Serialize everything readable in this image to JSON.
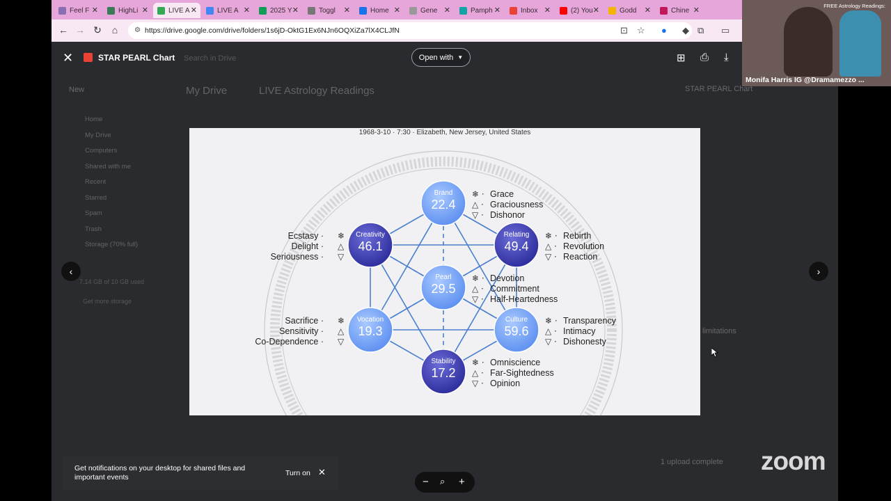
{
  "tabs": [
    {
      "label": "Feel F",
      "color": "#8a6fb0"
    },
    {
      "label": "HighLi",
      "color": "#3b7a57"
    },
    {
      "label": "LIVE A",
      "color": "#34a853",
      "active": true
    },
    {
      "label": "LIVE A",
      "color": "#4285f4"
    },
    {
      "label": "2025 Y",
      "color": "#0f9d58"
    },
    {
      "label": "Toggl",
      "color": "#777777"
    },
    {
      "label": "Home",
      "color": "#1a73e8"
    },
    {
      "label": "Gene",
      "color": "#999999"
    },
    {
      "label": "Pamph",
      "color": "#12a4a4"
    },
    {
      "label": "Inbox",
      "color": "#ea4335"
    },
    {
      "label": "(2) You",
      "color": "#ff0000"
    },
    {
      "label": "Godd",
      "color": "#f4b400"
    },
    {
      "label": "Chine",
      "color": "#c2185b"
    }
  ],
  "address": {
    "url": "https://drive.google.com/drive/folders/1s6jD-OktG1Ex6NJn6OQXiZa7lX4CLJfN"
  },
  "viewer": {
    "file_title": "STAR PEARL Chart",
    "open_with": "Open with",
    "bg_search": "Search in Drive",
    "bg_breadcrumb_1": "My Drive",
    "bg_breadcrumb_2": "LIVE Astrology Readings",
    "bg_new": "New",
    "bg_side_items": [
      "Home",
      "My Drive",
      "Computers",
      "Shared with me",
      "Recent",
      "Starred",
      "Spam",
      "Trash",
      "Storage (70% full)"
    ],
    "bg_storage": "7.14 GB of 10 GB used",
    "bg_get_storage": "Get more storage",
    "bg_right_title": "STAR PEARL Chart",
    "bg_upload": "1 upload complete",
    "bg_limitations": "limitations"
  },
  "chart": {
    "header": "1968-3-10 · 7:30 · Elizabeth, New Jersey, United States",
    "nodes": [
      {
        "name": "Brand",
        "value": "22.4",
        "traits": [
          "Grace",
          "Graciousness",
          "Dishonor"
        ],
        "side": "right"
      },
      {
        "name": "Creativity",
        "value": "46.1",
        "traits": [
          "Ecstasy",
          "Delight",
          "Seriousness"
        ],
        "side": "left"
      },
      {
        "name": "Relating",
        "value": "49.4",
        "traits": [
          "Rebirth",
          "Revolution",
          "Reaction"
        ],
        "side": "right"
      },
      {
        "name": "Pearl",
        "value": "29.5",
        "traits": [
          "Devotion",
          "Commitment",
          "Half-Heartedness"
        ],
        "side": "right"
      },
      {
        "name": "Vocation",
        "value": "19.3",
        "traits": [
          "Sacrifice",
          "Sensitivity",
          "Co-Dependence"
        ],
        "side": "left"
      },
      {
        "name": "Culture",
        "value": "59.6",
        "traits": [
          "Transparency",
          "Intimacy",
          "Dishonesty"
        ],
        "side": "right"
      },
      {
        "name": "Stability",
        "value": "17.2",
        "traits": [
          "Omniscience",
          "Far-Sightedness",
          "Opinion"
        ],
        "side": "right"
      }
    ],
    "colors": {
      "light": "#5b8ef0",
      "dark": "#2b2a9a",
      "line": "#4a7fd0"
    }
  },
  "toast": {
    "message": "Get notifications on your desktop for shared files and important events",
    "action": "Turn on"
  },
  "zoom": {
    "logo": "zoom"
  },
  "video": {
    "caption": "Monifa Harris IG @Dramamezzo ...",
    "top_text": "FREE Astrology Readings:"
  }
}
